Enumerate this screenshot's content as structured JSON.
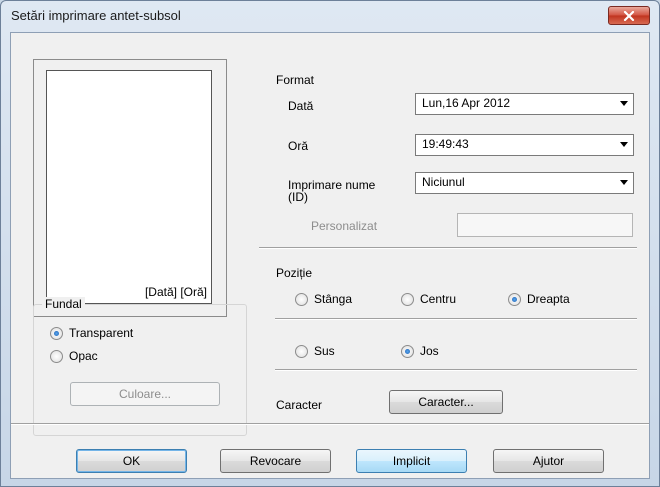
{
  "window": {
    "title": "Setări imprimare antet-subsol"
  },
  "preview": {
    "label": "[Dată] [Oră]"
  },
  "background": {
    "title": "Fundal",
    "options": [
      {
        "label": "Transparent",
        "selected": true
      },
      {
        "label": "Opac",
        "selected": false
      }
    ],
    "color_button": "Culoare..."
  },
  "format": {
    "title": "Format",
    "date_label": "Dată",
    "date_value": "Lun,16 Apr 2012",
    "time_label": "Oră",
    "time_value": "19:49:43",
    "name_label": "Imprimare nume",
    "name_label_sub": "(ID)",
    "name_value": "Niciunul",
    "custom_label": "Personalizat",
    "custom_value": ""
  },
  "position": {
    "title": "Poziție",
    "horizontal": [
      {
        "label": "Stânga",
        "selected": false
      },
      {
        "label": "Centru",
        "selected": false
      },
      {
        "label": "Dreapta",
        "selected": true
      }
    ],
    "vertical": [
      {
        "label": "Sus",
        "selected": false
      },
      {
        "label": "Jos",
        "selected": true
      }
    ]
  },
  "character": {
    "label": "Caracter",
    "button": "Caracter..."
  },
  "buttons": {
    "ok": "OK",
    "cancel": "Revocare",
    "default": "Implicit",
    "help": "Ajutor"
  }
}
